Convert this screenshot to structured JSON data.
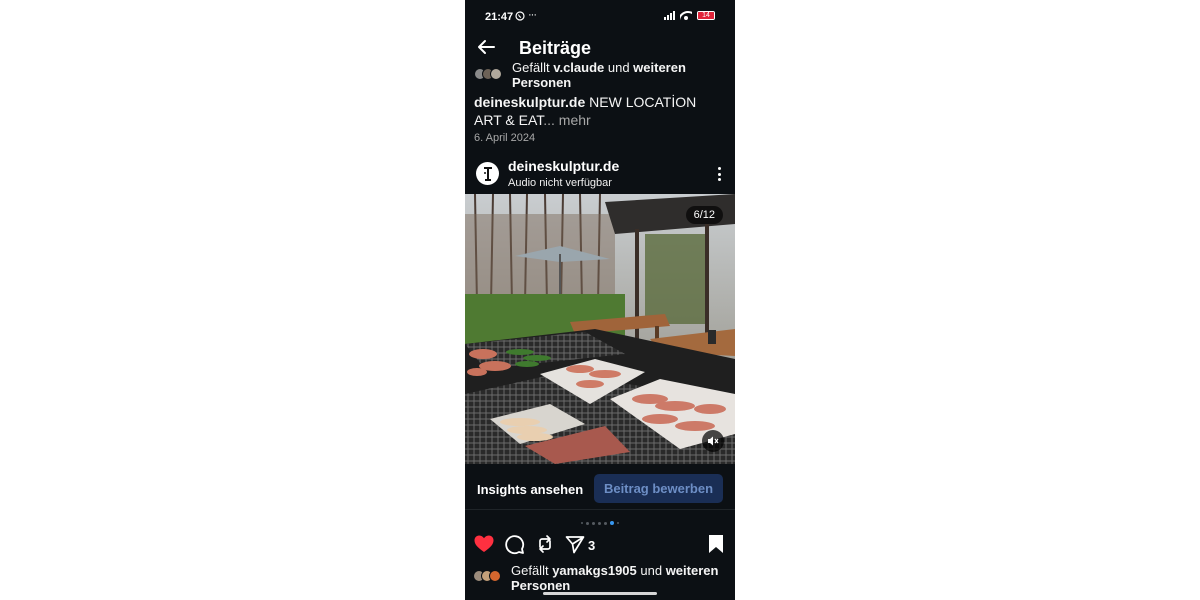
{
  "status": {
    "time": "21:47",
    "whatsapp_icon": "whatsapp-icon",
    "more": "···",
    "battery": "14",
    "battery_color": "#e0243a"
  },
  "header": {
    "back_icon": "back-arrow-icon",
    "title": "Beiträge"
  },
  "prev_post": {
    "likes_prefix": "Gefällt ",
    "likes_user": "v.claude",
    "likes_and": " und ",
    "likes_others": "weiteren Personen",
    "caption_user": "deineskulptur.de",
    "caption_text": " NEW LOCATİON ART & EAT",
    "caption_more": "... mehr",
    "date": "6. April 2024"
  },
  "post": {
    "username": "deineskulptur.de",
    "audio": "Audio nicht verfügbar",
    "media_counter": "6/12",
    "insights_label": "Insights ansehen",
    "promote_label": "Beitrag bewerben",
    "promote_bg": "#1a2e55",
    "share_count": "3",
    "likes_prefix": "Gefällt ",
    "likes_user": "yamakgs1905",
    "likes_and": " und ",
    "likes_others": "weiteren Personen",
    "like_color": "#ff3040",
    "carousel_active_color": "#3897f0"
  }
}
